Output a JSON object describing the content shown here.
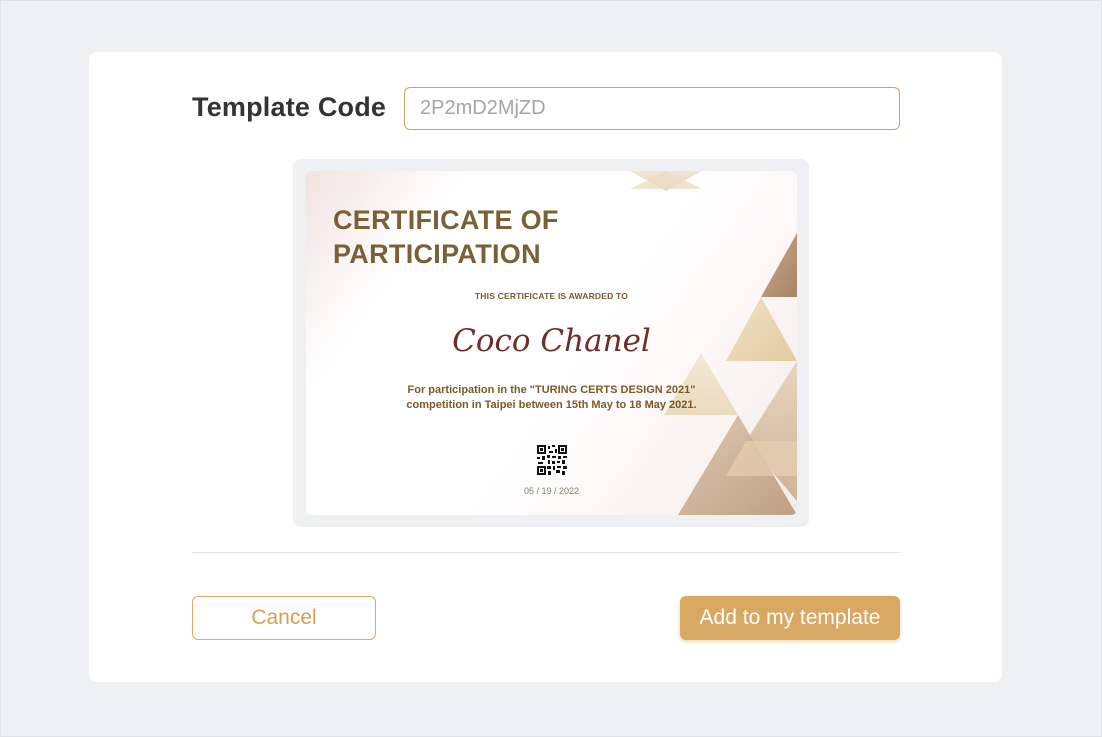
{
  "template_code": {
    "label": "Template Code",
    "value": "2P2mD2MjZD"
  },
  "certificate": {
    "title_line1": "CERTIFICATE OF",
    "title_line2": "PARTICIPATION",
    "awarded_text": "THIS CERTIFICATE IS AWARDED TO",
    "recipient": "Coco Chanel",
    "description_line1": "For participation in the \"TURING CERTS DESIGN 2021\"",
    "description_line2": "competition in Taipei between 15th May to 18 May 2021.",
    "date": "05 / 19 / 2022",
    "qr_icon": "qr-code-icon"
  },
  "actions": {
    "cancel_label": "Cancel",
    "add_label": "Add to my template"
  },
  "colors": {
    "accent": "#d8a862",
    "title": "#7a6034",
    "recipient": "#6e2c2a",
    "page_background": "#eef0f4"
  }
}
